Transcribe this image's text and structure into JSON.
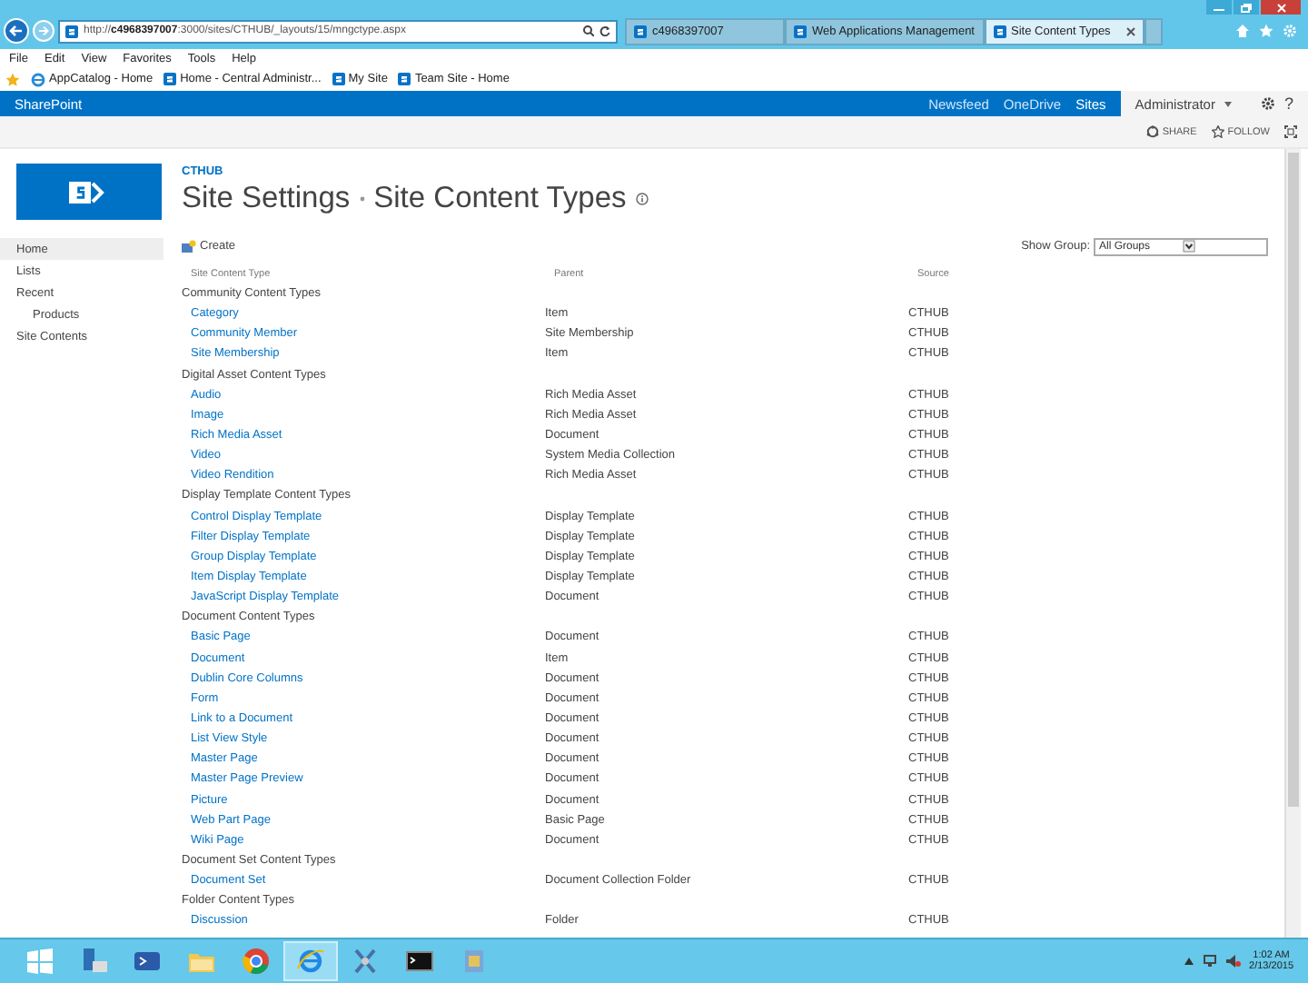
{
  "browser": {
    "address": "http://**c4968397007**:3000/sites/CTHUB/_layouts/15/mngctype.aspx",
    "tabs": [
      {
        "title": "c4968397007",
        "selected": false
      },
      {
        "title": "Web Applications Management",
        "selected": false
      },
      {
        "title": "Site Content Types",
        "selected": true
      }
    ],
    "menu": [
      "File",
      "Edit",
      "View",
      "Favorites",
      "Tools",
      "Help"
    ],
    "favorites": [
      {
        "kind": "ie",
        "label": "AppCatalog - Home"
      },
      {
        "kind": "sp",
        "label": "Home - Central Administr..."
      },
      {
        "kind": "sp",
        "label": "My Site"
      },
      {
        "kind": "sp",
        "label": "Team Site - Home"
      }
    ]
  },
  "suite_bar": {
    "brand": "SharePoint",
    "links": [
      {
        "label": "Newsfeed",
        "selected": false
      },
      {
        "label": "OneDrive",
        "selected": false
      },
      {
        "label": "Sites",
        "selected": true
      }
    ],
    "user": "Administrator",
    "help": "?"
  },
  "ribbon": {
    "actions": [
      {
        "kind": "share",
        "label": "SHARE"
      },
      {
        "kind": "follow",
        "label": "FOLLOW"
      }
    ]
  },
  "site": {
    "breadcrumb": "CTHUB",
    "title": "Site Settings",
    "page": "Site Content Types"
  },
  "nav": [
    {
      "label": "Home",
      "selected": true
    },
    {
      "label": "Lists",
      "selected": false
    },
    {
      "label": "Recent",
      "selected": false,
      "children": [
        {
          "label": "Products",
          "selected": false
        }
      ]
    },
    {
      "label": "Site Contents",
      "selected": false
    }
  ],
  "toolbar": {
    "create": "Create",
    "show_group_label": "Show Group:",
    "show_group_value": "All Groups"
  },
  "table": {
    "columns": [
      "Site Content Type",
      "Parent",
      "Source"
    ],
    "groups": [
      {
        "name": "Community Content Types",
        "rows": [
          [
            "Category",
            "Item",
            "CTHUB"
          ],
          [
            "Community Member",
            "Site Membership",
            "CTHUB"
          ],
          [
            "Site Membership",
            "Item",
            "CTHUB"
          ]
        ]
      },
      {
        "name": "Digital Asset Content Types",
        "rows": [
          [
            "Audio",
            "Rich Media Asset",
            "CTHUB"
          ],
          [
            "Image",
            "Rich Media Asset",
            "CTHUB"
          ],
          [
            "Rich Media Asset",
            "Document",
            "CTHUB"
          ],
          [
            "Video",
            "System Media Collection",
            "CTHUB"
          ],
          [
            "Video Rendition",
            "Rich Media Asset",
            "CTHUB"
          ]
        ]
      },
      {
        "name": "Display Template Content Types",
        "rows": [
          [
            "Control Display Template",
            "Display Template",
            "CTHUB"
          ],
          [
            "Filter Display Template",
            "Display Template",
            "CTHUB"
          ],
          [
            "Group Display Template",
            "Display Template",
            "CTHUB"
          ],
          [
            "Item Display Template",
            "Display Template",
            "CTHUB"
          ],
          [
            "JavaScript Display Template",
            "Document",
            "CTHUB"
          ]
        ]
      },
      {
        "name": "Document Content Types",
        "rows": [
          [
            "Basic Page",
            "Document",
            "CTHUB"
          ],
          [
            "Document",
            "Item",
            "CTHUB"
          ],
          [
            "Dublin Core Columns",
            "Document",
            "CTHUB"
          ],
          [
            "Form",
            "Document",
            "CTHUB"
          ],
          [
            "Link to a Document",
            "Document",
            "CTHUB"
          ],
          [
            "List View Style",
            "Document",
            "CTHUB"
          ],
          [
            "Master Page",
            "Document",
            "CTHUB"
          ],
          [
            "Master Page Preview",
            "Document",
            "CTHUB"
          ],
          [
            "Picture",
            "Document",
            "CTHUB"
          ],
          [
            "Web Part Page",
            "Basic Page",
            "CTHUB"
          ],
          [
            "Wiki Page",
            "Document",
            "CTHUB"
          ]
        ]
      },
      {
        "name": "Document Set Content Types",
        "rows": [
          [
            "Document Set",
            "Document Collection Folder",
            "CTHUB"
          ]
        ]
      },
      {
        "name": "Folder Content Types",
        "rows": [
          [
            "Discussion",
            "Folder",
            "CTHUB"
          ]
        ]
      }
    ]
  },
  "taskbar": {
    "apps": [
      {
        "kind": "server",
        "selected": false
      },
      {
        "kind": "shell",
        "selected": false
      },
      {
        "kind": "folder",
        "selected": false
      },
      {
        "kind": "chrome",
        "selected": false
      },
      {
        "kind": "ie",
        "selected": true
      },
      {
        "kind": "tool",
        "selected": false
      },
      {
        "kind": "cmd",
        "selected": false
      },
      {
        "kind": "setup",
        "selected": false
      }
    ],
    "time": "1:02 AM",
    "date": "2/13/2015"
  }
}
